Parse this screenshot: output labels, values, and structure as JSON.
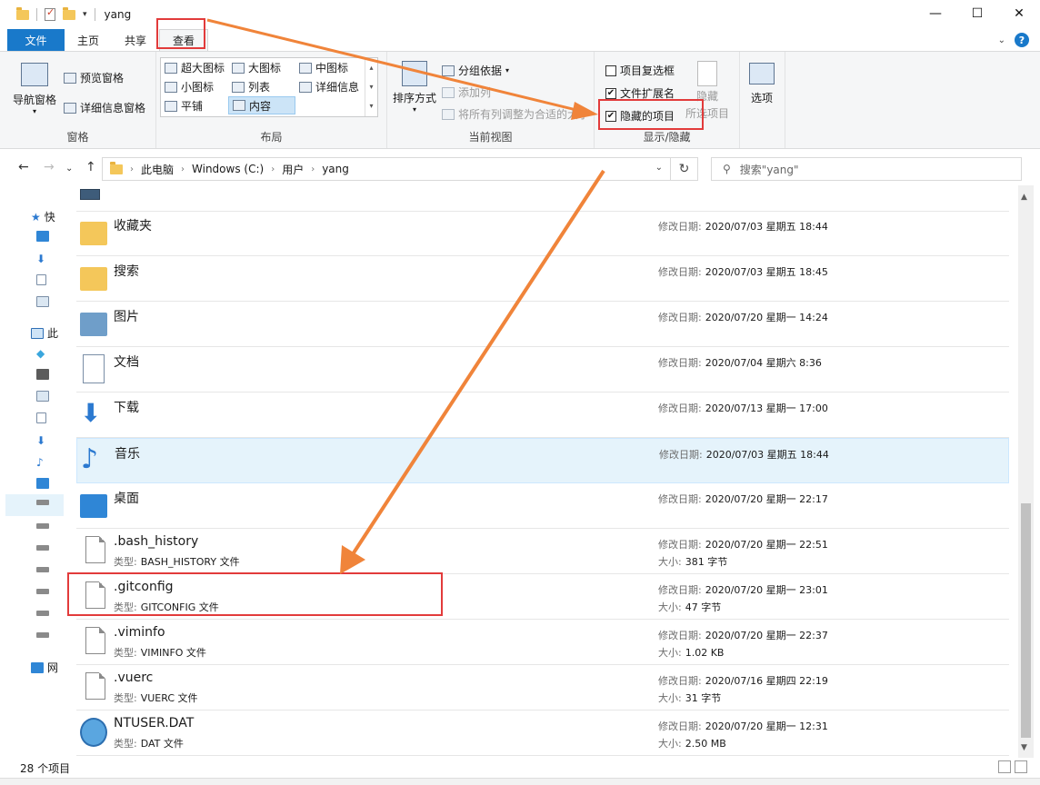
{
  "window": {
    "title": "yang",
    "controls": {
      "minimize": "—",
      "maximize": "☐",
      "close": "✕"
    }
  },
  "tabs": {
    "file": "文件",
    "home": "主页",
    "share": "共享",
    "view": "查看",
    "help": "?"
  },
  "ribbon": {
    "panes": {
      "nav_pane": "导航窗格",
      "preview_pane": "预览窗格",
      "details_pane": "详细信息窗格",
      "group_title": "窗格"
    },
    "layout": {
      "extra_large": "超大图标",
      "large": "大图标",
      "medium": "中图标",
      "small": "小图标",
      "list": "列表",
      "details": "详细信息",
      "tiles": "平铺",
      "content": "内容",
      "group_title": "布局"
    },
    "current_view": {
      "sort_by": "排序方式",
      "group_by": "分组依据",
      "add_columns": "添加列",
      "size_columns": "将所有列调整为合适的大小",
      "group_title": "当前视图"
    },
    "show_hide": {
      "item_checkboxes": "项目复选框",
      "file_extensions": "文件扩展名",
      "hidden_items": "隐藏的项目",
      "hide_selected_1": "隐藏",
      "hide_selected_2": "所选项目",
      "group_title": "显示/隐藏",
      "item_checkboxes_checked": false,
      "file_extensions_checked": true,
      "hidden_items_checked": true
    },
    "options": "选项"
  },
  "address": {
    "crumbs": [
      "此电脑",
      "Windows (C:)",
      "用户",
      "yang"
    ],
    "search_placeholder": "搜索\"yang\""
  },
  "nav": {
    "quick_access": "快",
    "this_pc": "此",
    "network": "网"
  },
  "files": [
    {
      "name": "收藏夹",
      "date_label": "修改日期:",
      "date": "2020/07/03 星期五 18:44",
      "icon": "favorites-folder-icon"
    },
    {
      "name": "搜索",
      "date_label": "修改日期:",
      "date": "2020/07/03 星期五 18:45",
      "icon": "search-folder-icon"
    },
    {
      "name": "图片",
      "date_label": "修改日期:",
      "date": "2020/07/20 星期一 14:24",
      "icon": "pictures-folder-icon"
    },
    {
      "name": "文档",
      "date_label": "修改日期:",
      "date": "2020/07/04 星期六 8:36",
      "icon": "documents-folder-icon"
    },
    {
      "name": "下载",
      "date_label": "修改日期:",
      "date": "2020/07/13 星期一 17:00",
      "icon": "downloads-folder-icon"
    },
    {
      "name": "音乐",
      "date_label": "修改日期:",
      "date": "2020/07/03 星期五 18:44",
      "icon": "music-folder-icon"
    },
    {
      "name": "桌面",
      "date_label": "修改日期:",
      "date": "2020/07/20 星期一 22:17",
      "icon": "desktop-folder-icon"
    },
    {
      "name": ".bash_history",
      "type_label": "类型:",
      "type": "BASH_HISTORY 文件",
      "date_label": "修改日期:",
      "date": "2020/07/20 星期一 22:51",
      "size_label": "大小:",
      "size": "381 字节",
      "icon": "file-icon"
    },
    {
      "name": ".gitconfig",
      "type_label": "类型:",
      "type": "GITCONFIG 文件",
      "date_label": "修改日期:",
      "date": "2020/07/20 星期一 23:01",
      "size_label": "大小:",
      "size": "47 字节",
      "icon": "file-icon"
    },
    {
      "name": ".viminfo",
      "type_label": "类型:",
      "type": "VIMINFO 文件",
      "date_label": "修改日期:",
      "date": "2020/07/20 星期一 22:37",
      "size_label": "大小:",
      "size": "1.02 KB",
      "icon": "file-icon"
    },
    {
      "name": ".vuerc",
      "type_label": "类型:",
      "type": "VUERC 文件",
      "date_label": "修改日期:",
      "date": "2020/07/16 星期四 22:19",
      "size_label": "大小:",
      "size": "31 字节",
      "icon": "file-icon"
    },
    {
      "name": "NTUSER.DAT",
      "type_label": "类型:",
      "type": "DAT 文件",
      "date_label": "修改日期:",
      "date": "2020/07/20 星期一 12:31",
      "size_label": "大小:",
      "size": "2.50 MB",
      "icon": "media-file-icon"
    }
  ],
  "status": {
    "item_count": "28 个项目"
  },
  "colors": {
    "accent": "#1979ca",
    "highlight_box": "#e23b3b",
    "annotation_arrow": "#f0843a"
  }
}
